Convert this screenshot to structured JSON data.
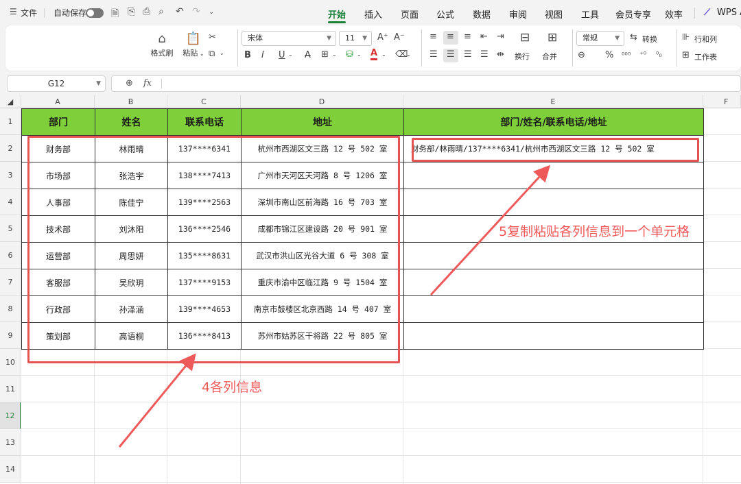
{
  "menubar": {
    "file_label": "文件",
    "autosave_label": "自动保存",
    "tabs": [
      "开始",
      "插入",
      "页面",
      "公式",
      "数据",
      "审阅",
      "视图",
      "工具",
      "会员专享",
      "效率"
    ],
    "wps_label": "WPS A"
  },
  "ribbon": {
    "format_painter": "格式刷",
    "paste": "粘贴",
    "font_name": "宋体",
    "font_size": "11",
    "wrap": "换行",
    "merge": "合并",
    "number_format": "常规",
    "convert": "转换",
    "row_col": "行和列",
    "worksheet": "工作表"
  },
  "formula_bar": {
    "cell_ref": "G12",
    "fx": "fx",
    "content": ""
  },
  "sheet": {
    "columns": [
      "A",
      "B",
      "C",
      "D",
      "E",
      "F"
    ],
    "rows": [
      "1",
      "2",
      "3",
      "4",
      "5",
      "6",
      "7",
      "8",
      "9",
      "10",
      "11",
      "12",
      "13",
      "14"
    ],
    "active_row": "12",
    "headers": [
      "部门",
      "姓名",
      "联系电话",
      "地址",
      "部门/姓名/联系电话/地址"
    ],
    "data": [
      [
        "财务部",
        "林雨晴",
        "137****6341",
        "杭州市西湖区文三路 12 号 502 室"
      ],
      [
        "市场部",
        "张浩宇",
        "138****7413",
        "广州市天河区天河路 8 号 1206 室"
      ],
      [
        "人事部",
        "陈佳宁",
        "139****2563",
        "深圳市南山区前海路 16 号 703 室"
      ],
      [
        "技术部",
        "刘沐阳",
        "136****2546",
        "成都市锦江区建设路 20 号 901 室"
      ],
      [
        "运营部",
        "周思妍",
        "135****8631",
        "武汉市洪山区光谷大道 6 号 308 室"
      ],
      [
        "客服部",
        "吴欣玥",
        "137****9153",
        "重庆市渝中区临江路 9 号 1504 室"
      ],
      [
        "行政部",
        "孙泽涵",
        "139****4653",
        "南京市鼓楼区北京西路 14 号 407 室"
      ],
      [
        "策划部",
        "高语桐",
        "136****8413",
        "苏州市姑苏区干将路 22 号 805 室"
      ]
    ],
    "combined": [
      "财务部/林雨晴/137****6341/杭州市西湖区文三路 12 号 502 室",
      "",
      "",
      "",
      "",
      "",
      "",
      ""
    ]
  },
  "annotations": {
    "step5": "5复制粘贴各列信息到一个单元格",
    "step4": "4各列信息"
  },
  "colors": {
    "header_green": "#7fcf3a",
    "annotation_red": "#e55353",
    "accent_green": "#1a7f37"
  }
}
